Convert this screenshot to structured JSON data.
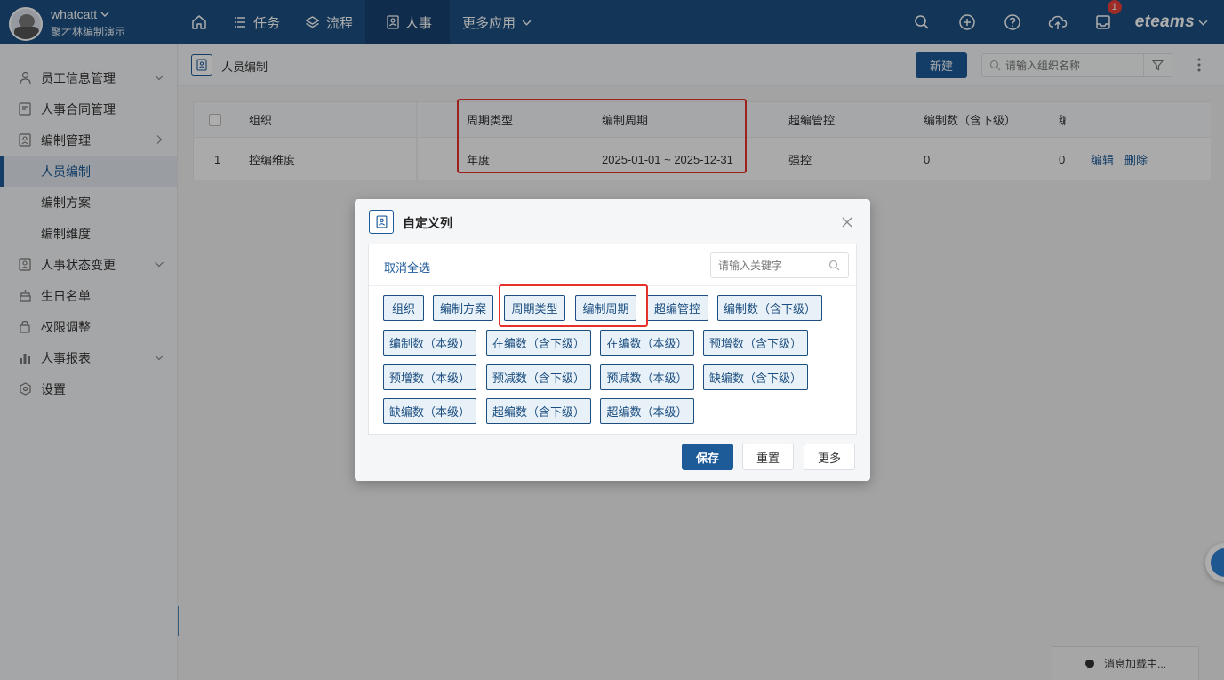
{
  "header": {
    "user_name": "whatcatt",
    "user_org": "聚才林编制演示",
    "nav": [
      "任务",
      "流程",
      "人事",
      "更多应用"
    ],
    "brand": "eteams",
    "badge_count": "1"
  },
  "sidebar": {
    "items": [
      {
        "label": "员工信息管理"
      },
      {
        "label": "人事合同管理"
      },
      {
        "label": "编制管理"
      },
      {
        "label": "人员编制"
      },
      {
        "label": "编制方案"
      },
      {
        "label": "编制维度"
      },
      {
        "label": "人事状态变更"
      },
      {
        "label": "生日名单"
      },
      {
        "label": "权限调整"
      },
      {
        "label": "人事报表"
      },
      {
        "label": "设置"
      }
    ]
  },
  "page": {
    "title": "人员编制",
    "new_label": "新建",
    "search_placeholder": "请输入组织名称"
  },
  "table": {
    "headers": [
      "组织",
      "周期类型",
      "编制周期",
      "超编管控",
      "编制数（含下级）",
      "编"
    ],
    "row": {
      "index": "1",
      "org": "控编维度",
      "cycle_type": "年度",
      "cycle": "2025-01-01 ~ 2025-12-31",
      "control": "强控",
      "count_sub": "0",
      "count": "0",
      "edit": "编辑",
      "delete": "删除"
    }
  },
  "modal": {
    "title": "自定义列",
    "deselect_all": "取消全选",
    "keyword_placeholder": "请输入关键字",
    "chips": [
      "组织",
      "编制方案",
      "周期类型",
      "编制周期",
      "超编管控",
      "编制数（含下级）",
      "编制数（本级）",
      "在编数（含下级）",
      "在编数（本级）",
      "预增数（含下级）",
      "预增数（本级）",
      "预减数（含下级）",
      "预减数（本级）",
      "缺编数（含下级）",
      "缺编数（本级）",
      "超编数（含下级）",
      "超编数（本级）"
    ],
    "save": "保存",
    "reset": "重置",
    "more": "更多"
  },
  "message": {
    "loading": "消息加载中..."
  },
  "colors": {
    "primary": "#1c5a98",
    "topbar": "#1c4f80",
    "highlight": "#e8302a",
    "badge": "#e8413a"
  }
}
